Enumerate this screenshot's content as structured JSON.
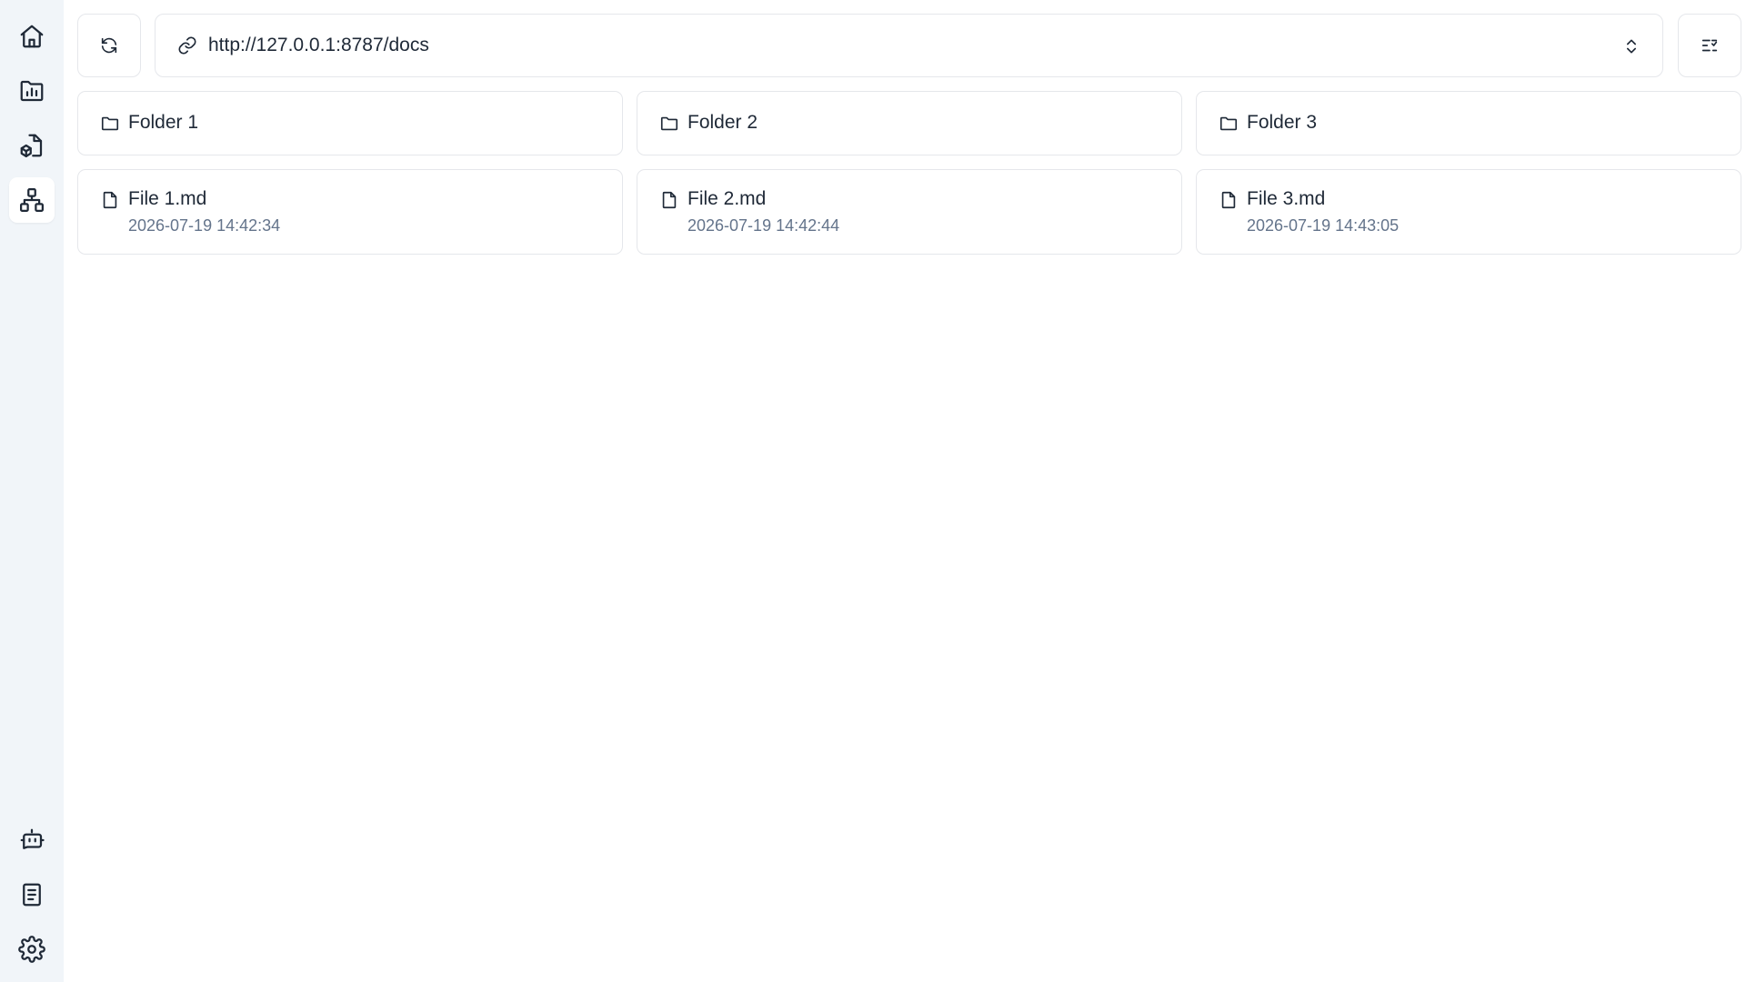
{
  "address": {
    "url": "http://127.0.0.1:8787/docs"
  },
  "sidebar": {
    "items": [
      {
        "icon": "home-icon"
      },
      {
        "icon": "folder-chart-icon"
      },
      {
        "icon": "file-box-icon"
      },
      {
        "icon": "network-icon",
        "active": true
      }
    ],
    "bottom_items": [
      {
        "icon": "bot-icon"
      },
      {
        "icon": "book-icon"
      },
      {
        "icon": "gear-icon"
      }
    ]
  },
  "folders": [
    {
      "name": "Folder 1"
    },
    {
      "name": "Folder 2"
    },
    {
      "name": "Folder 3"
    }
  ],
  "files": [
    {
      "name": "File 1.md",
      "date": "2026-07-19 14:42:34"
    },
    {
      "name": "File 2.md",
      "date": "2026-07-19 14:42:44"
    },
    {
      "name": "File 3.md",
      "date": "2026-07-19 14:43:05"
    }
  ],
  "colors": {
    "sidebar_bg": "#f1f5f9",
    "border": "#e5e7eb",
    "text": "#1f2937",
    "muted": "#64748b"
  }
}
